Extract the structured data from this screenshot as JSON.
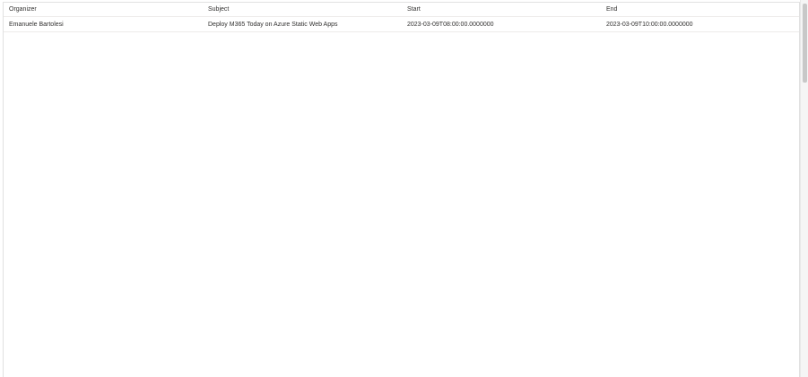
{
  "table": {
    "columns": [
      "Organizer",
      "Subject",
      "Start",
      "End"
    ],
    "rows": [
      {
        "organizer": "Emanuele Bartolesi",
        "subject": "Deploy M365 Today on Azure Static Web Apps",
        "start": "2023-03-09T08:00:00.0000000",
        "end": "2023-03-09T10:00:00.0000000"
      }
    ]
  }
}
